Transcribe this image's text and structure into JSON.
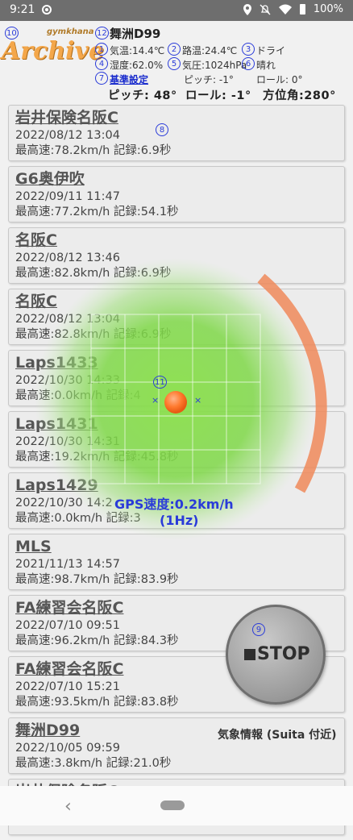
{
  "status_bar": {
    "time": "9:21",
    "battery": "100%",
    "icons": [
      "sync-icon",
      "location-icon",
      "mute-icon",
      "wifi-icon",
      "battery-icon"
    ]
  },
  "header": {
    "logo_small": "gymkhana",
    "logo_main": "Archive",
    "markers": {
      "m1": "1",
      "m2": "2",
      "m3": "3",
      "m4": "4",
      "m5": "5",
      "m6": "6",
      "m7": "7",
      "m8": "8",
      "m9": "9",
      "m10": "10",
      "m11": "11",
      "m12": "12"
    },
    "location": "舞洲D99",
    "air_temp": "気温:14.4℃",
    "road_temp": "路温:24.4℃",
    "condition_road": "ドライ",
    "humidity": "湿度:62.0%",
    "pressure": "気圧:1024hPa",
    "weather": "晴れ",
    "calibrate_link": "基準設定",
    "pitch_ref": "ピッチ: -1°",
    "roll_ref": "ロール: 0°",
    "pitch": "ピッチ: 48°",
    "roll": "ロール: -1°",
    "azimuth": "方位角:280°"
  },
  "records": [
    {
      "name": "岩井保険名阪C",
      "datetime": "2022/08/12 13:04",
      "stats": "最高速:78.2km/h 記録:6.9秒"
    },
    {
      "name": "G6奥伊吹",
      "datetime": "2022/09/11 11:47",
      "stats": "最高速:77.2km/h 記録:54.1秒"
    },
    {
      "name": "名阪C",
      "datetime": "2022/08/12 13:46",
      "stats": "最高速:82.8km/h 記録:6.9秒"
    },
    {
      "name": "名阪C",
      "datetime": "2022/08/12 13:04",
      "stats": "最高速:82.8km/h 記録:6.9秒"
    },
    {
      "name": "Laps1433",
      "datetime": "2022/10/30 14:33",
      "stats": "最高速:0.0km/h 記録:4"
    },
    {
      "name": "Laps1431",
      "datetime": "2022/10/30 14:31",
      "stats": "最高速:19.2km/h 記録:45.8秒"
    },
    {
      "name": "Laps1429",
      "datetime": "2022/10/30 14:2",
      "stats": "最高速:0.0km/h 記録:3"
    },
    {
      "name": "MLS",
      "datetime": "2021/11/13 14:57",
      "stats": "最高速:98.7km/h 記録:83.9秒"
    },
    {
      "name": "FA練習会名阪C",
      "datetime": "2022/07/10 09:51",
      "stats": "最高速:96.2km/h 記録:84.3秒"
    },
    {
      "name": "FA練習会名阪C",
      "datetime": "2022/07/10 15:21",
      "stats": "最高速:93.5km/h 記録:83.8秒"
    },
    {
      "name": "舞洲D99",
      "datetime": "2022/10/05 09:59",
      "stats": "最高速:3.8km/h 記録:21.0秒"
    },
    {
      "name": "岩井保険名阪C",
      "datetime": "",
      "stats": ""
    }
  ],
  "gps": {
    "speed": "GPS速度:0.2km/h",
    "rate": "(1Hz)"
  },
  "stop_button": {
    "label": "STOP"
  },
  "weather_info": "気象情報 (Suita 付近)",
  "colors": {
    "accent_blue": "#2a3bd9",
    "gauge_green": "#7fd848",
    "gauge_arc": "#f08a5a",
    "dot_orange": "#ff7a2e",
    "logo_orange": "#f4a74a"
  }
}
